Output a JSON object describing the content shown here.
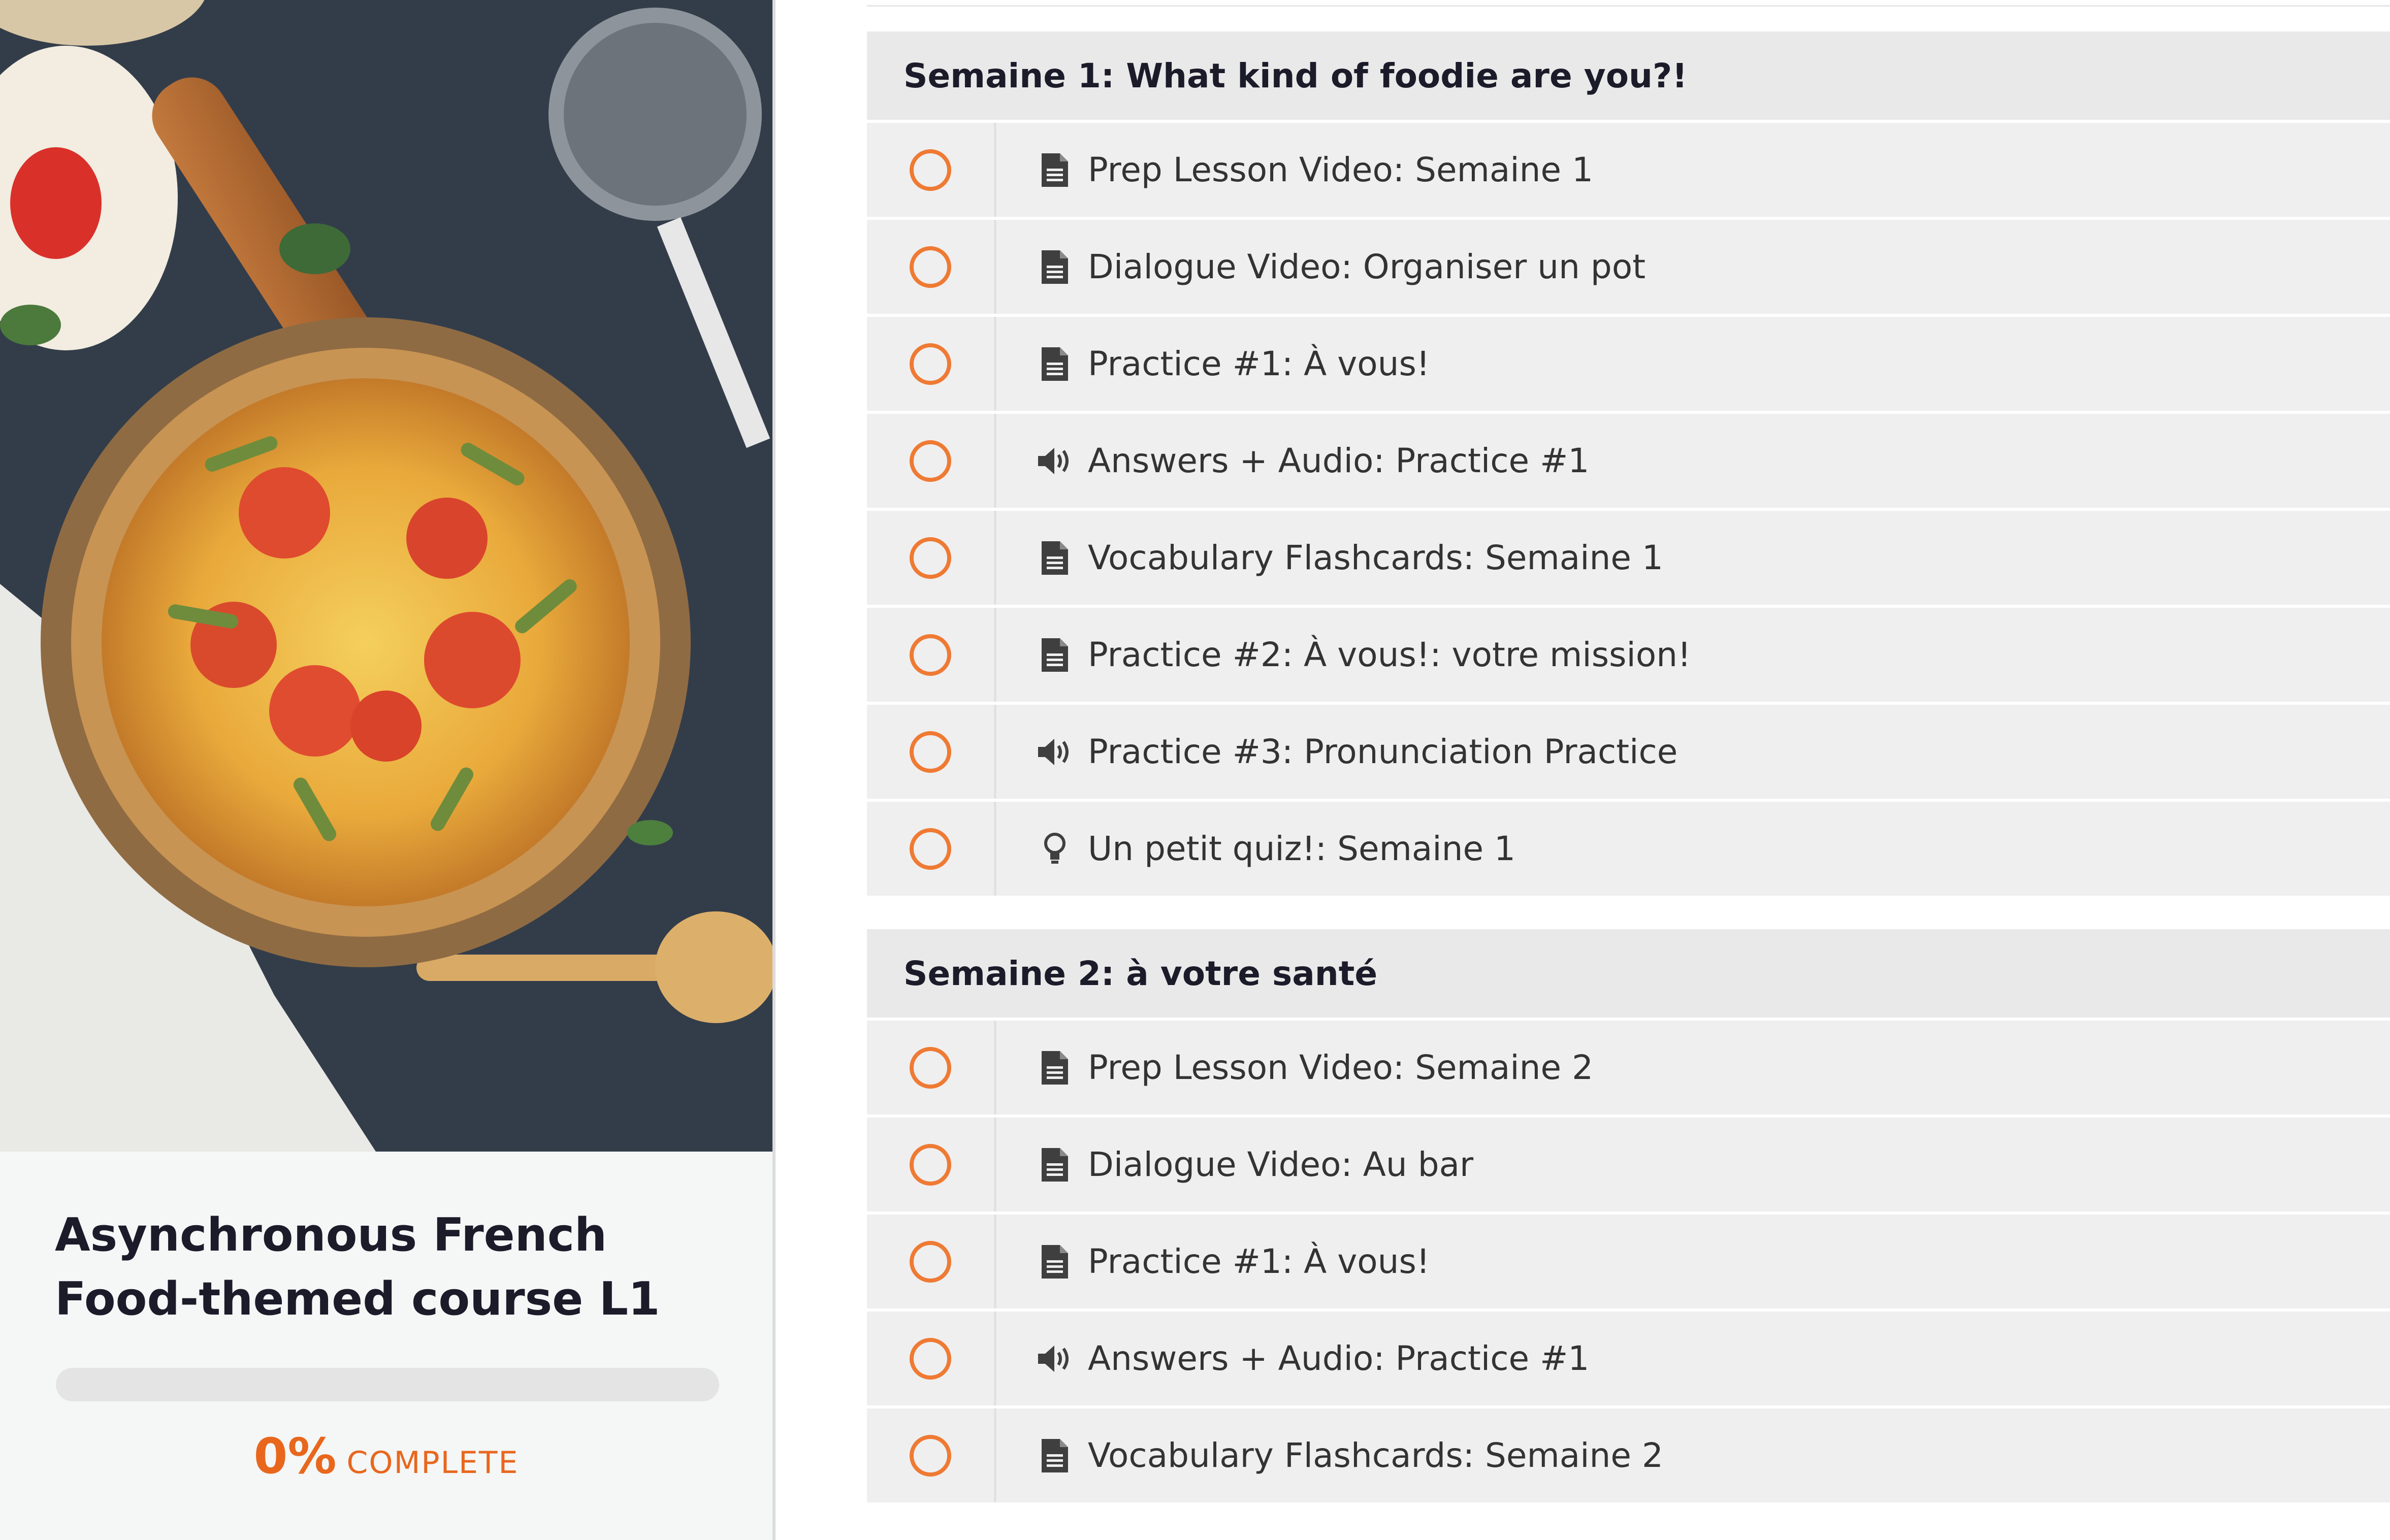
{
  "course": {
    "title": "Asynchronous French Food-themed course L1",
    "progress_percent": 0,
    "progress_value_label": "0%",
    "progress_word": "COMPLETE",
    "accent_color": "#e8671d"
  },
  "sections": [
    {
      "title": "Semaine 1: What kind of foodie are you?!",
      "lessons": [
        {
          "icon": "document-icon",
          "label": "Prep Lesson Video: Semaine 1"
        },
        {
          "icon": "document-icon",
          "label": "Dialogue Video: Organiser un pot"
        },
        {
          "icon": "document-icon",
          "label": "Practice #1: À vous!"
        },
        {
          "icon": "audio-icon",
          "label": "Answers + Audio: Practice #1"
        },
        {
          "icon": "document-icon",
          "label": "Vocabulary Flashcards: Semaine 1"
        },
        {
          "icon": "document-icon",
          "label": "Practice #2: À vous!: votre mission!"
        },
        {
          "icon": "audio-icon",
          "label": "Practice #3: Pronunciation Practice"
        },
        {
          "icon": "lightbulb-icon",
          "label": "Un petit quiz!: Semaine 1"
        }
      ]
    },
    {
      "title": "Semaine 2: à votre santé",
      "lessons": [
        {
          "icon": "document-icon",
          "label": "Prep Lesson Video: Semaine 2"
        },
        {
          "icon": "document-icon",
          "label": "Dialogue Video: Au bar"
        },
        {
          "icon": "document-icon",
          "label": "Practice #1: À vous!"
        },
        {
          "icon": "audio-icon",
          "label": "Answers + Audio: Practice #1"
        },
        {
          "icon": "document-icon",
          "label": "Vocabulary Flashcards: Semaine 2"
        }
      ]
    }
  ]
}
